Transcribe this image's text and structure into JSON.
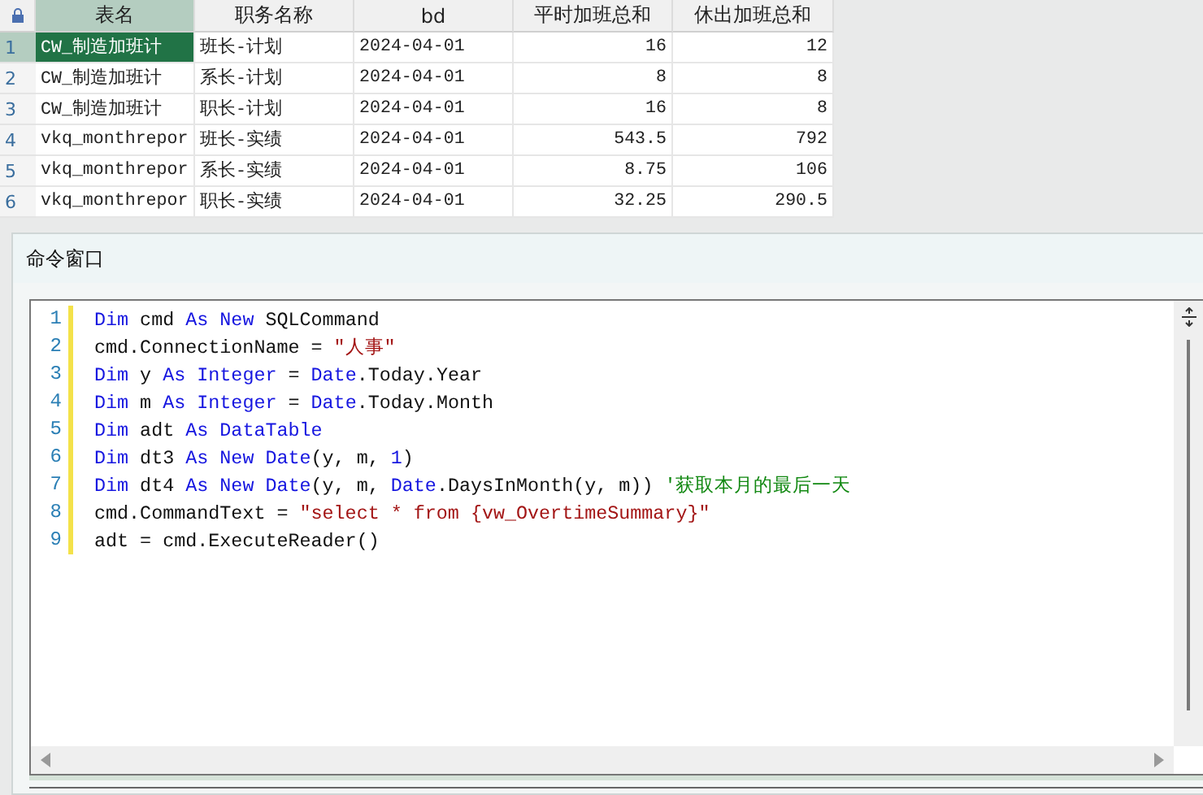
{
  "grid": {
    "columns": [
      "表名",
      "职务名称",
      "bd",
      "平时加班总和",
      "休出加班总和"
    ],
    "rows": [
      {
        "number": "1",
        "selected": true,
        "cells": [
          "CW_制造加班计",
          "班长-计划",
          "2024-04-01",
          "16",
          "12"
        ]
      },
      {
        "number": "2",
        "selected": false,
        "cells": [
          "CW_制造加班计",
          "系长-计划",
          "2024-04-01",
          "8",
          "8"
        ]
      },
      {
        "number": "3",
        "selected": false,
        "cells": [
          "CW_制造加班计",
          "职长-计划",
          "2024-04-01",
          "16",
          "8"
        ]
      },
      {
        "number": "4",
        "selected": false,
        "cells": [
          "vkq_monthrepor",
          "班长-实绩",
          "2024-04-01",
          "543.5",
          "792"
        ]
      },
      {
        "number": "5",
        "selected": false,
        "cells": [
          "vkq_monthrepor",
          "系长-实绩",
          "2024-04-01",
          "8.75",
          "106"
        ]
      },
      {
        "number": "6",
        "selected": false,
        "cells": [
          "vkq_monthrepor",
          "职长-实绩",
          "2024-04-01",
          "32.25",
          "290.5"
        ]
      }
    ]
  },
  "command_window": {
    "title": "命令窗口",
    "lines": [
      {
        "number": "1",
        "tokens": [
          {
            "kind": "keyword",
            "text": "Dim"
          },
          {
            "kind": "plain",
            "text": " cmd "
          },
          {
            "kind": "keyword",
            "text": "As New"
          },
          {
            "kind": "plain",
            "text": " SQLCommand"
          }
        ]
      },
      {
        "number": "2",
        "tokens": [
          {
            "kind": "plain",
            "text": "cmd.ConnectionName = "
          },
          {
            "kind": "string",
            "text": "\"人事\""
          }
        ]
      },
      {
        "number": "3",
        "tokens": [
          {
            "kind": "keyword",
            "text": "Dim"
          },
          {
            "kind": "plain",
            "text": " y "
          },
          {
            "kind": "keyword",
            "text": "As Integer"
          },
          {
            "kind": "plain",
            "text": " = "
          },
          {
            "kind": "keyword",
            "text": "Date"
          },
          {
            "kind": "plain",
            "text": ".Today.Year"
          }
        ]
      },
      {
        "number": "4",
        "tokens": [
          {
            "kind": "keyword",
            "text": "Dim"
          },
          {
            "kind": "plain",
            "text": " m "
          },
          {
            "kind": "keyword",
            "text": "As Integer"
          },
          {
            "kind": "plain",
            "text": " = "
          },
          {
            "kind": "keyword",
            "text": "Date"
          },
          {
            "kind": "plain",
            "text": ".Today.Month"
          }
        ]
      },
      {
        "number": "5",
        "tokens": [
          {
            "kind": "keyword",
            "text": "Dim"
          },
          {
            "kind": "plain",
            "text": " adt "
          },
          {
            "kind": "keyword",
            "text": "As DataTable"
          }
        ]
      },
      {
        "number": "6",
        "tokens": [
          {
            "kind": "keyword",
            "text": "Dim"
          },
          {
            "kind": "plain",
            "text": " dt3 "
          },
          {
            "kind": "keyword",
            "text": "As New Date"
          },
          {
            "kind": "plain",
            "text": "(y, m, "
          },
          {
            "kind": "number",
            "text": "1"
          },
          {
            "kind": "plain",
            "text": ")"
          }
        ]
      },
      {
        "number": "7",
        "tokens": [
          {
            "kind": "keyword",
            "text": "Dim"
          },
          {
            "kind": "plain",
            "text": " dt4 "
          },
          {
            "kind": "keyword",
            "text": "As New Date"
          },
          {
            "kind": "plain",
            "text": "(y, m, "
          },
          {
            "kind": "keyword",
            "text": "Date"
          },
          {
            "kind": "plain",
            "text": ".DaysInMonth(y, m)) "
          },
          {
            "kind": "comment",
            "text": "'获取本月的最后一天"
          }
        ]
      },
      {
        "number": "8",
        "tokens": [
          {
            "kind": "plain",
            "text": "cmd.CommandText = "
          },
          {
            "kind": "string",
            "text": "\"select * from {vw_OvertimeSummary}\""
          }
        ]
      },
      {
        "number": "9",
        "tokens": [
          {
            "kind": "plain",
            "text": "adt = cmd.ExecuteReader()"
          }
        ]
      }
    ]
  }
}
